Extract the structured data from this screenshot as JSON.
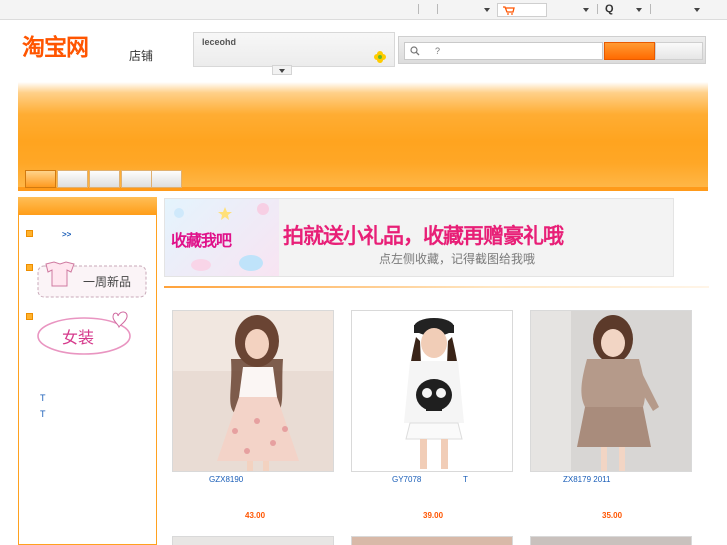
{
  "topbar": {
    "cart_label": "",
    "search_glyph": "Q"
  },
  "header": {
    "logo_text": "淘宝网",
    "logo_subtitle": "店铺",
    "shop_name": "leceohd",
    "search_placeholder": "?"
  },
  "nav": {
    "tabs": [
      "",
      "",
      "",
      "",
      ""
    ],
    "active_index": 0
  },
  "sidebar": {
    "more_link": ">>",
    "category_new_label": "一周新品",
    "category_women_label": "女装",
    "text_items": [
      "T",
      "T"
    ]
  },
  "promo": {
    "badge_text": "收藏我吧",
    "headline": "拍就送小礼品，收藏再赠豪礼哦",
    "subline": "点左侧收藏，记得截图给我哦"
  },
  "products": [
    {
      "code": "GZX8190",
      "price": "43.00",
      "icon": "floral-dress-photo"
    },
    {
      "code": "GY7078",
      "extra": "T",
      "price": "39.00",
      "icon": "skull-top-photo"
    },
    {
      "code": "ZX8179 2011",
      "price": "35.00",
      "icon": "beige-dress-photo"
    }
  ],
  "colors": {
    "brand_orange": "#ff5500",
    "banner_orange": "#ffa41f",
    "link_blue": "#1a5eb8",
    "promo_pink": "#e81f77"
  }
}
